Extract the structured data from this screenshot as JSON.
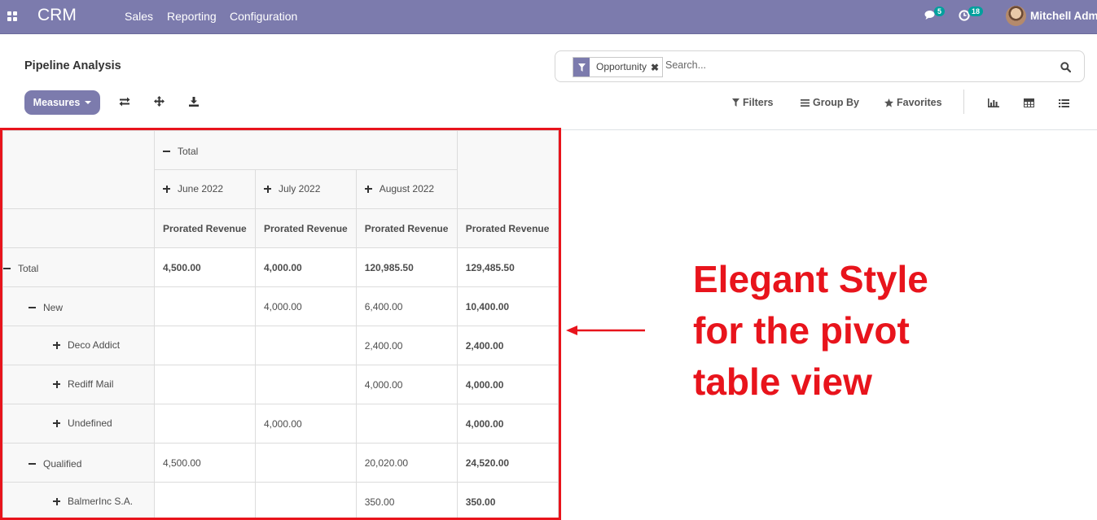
{
  "navbar": {
    "brand": "CRM",
    "menu": [
      "Sales",
      "Reporting",
      "Configuration"
    ],
    "messages_count": "5",
    "activities_count": "18",
    "user_name": "Mitchell Admin"
  },
  "control_panel": {
    "title": "Pipeline Analysis",
    "facet_value": "Opportunity",
    "search_placeholder": "Search...",
    "measures_label": "Measures",
    "filters_label": "Filters",
    "group_by_label": "Group By",
    "favorites_label": "Favorites"
  },
  "pivot": {
    "col_total_label": "Total",
    "col_groups": [
      "June 2022",
      "July 2022",
      "August 2022"
    ],
    "measure_label": "Prorated Revenue",
    "rows": [
      {
        "label": "Total",
        "values": [
          "4,500.00",
          "4,000.00",
          "120,985.50",
          "129,485.50"
        ]
      },
      {
        "label": "New",
        "values": [
          "",
          "4,000.00",
          "6,400.00",
          "10,400.00"
        ]
      },
      {
        "label": "Deco Addict",
        "values": [
          "",
          "",
          "2,400.00",
          "2,400.00"
        ]
      },
      {
        "label": "Rediff Mail",
        "values": [
          "",
          "",
          "4,000.00",
          "4,000.00"
        ]
      },
      {
        "label": "Undefined",
        "values": [
          "",
          "4,000.00",
          "",
          "4,000.00"
        ]
      },
      {
        "label": "Qualified",
        "values": [
          "4,500.00",
          "",
          "20,020.00",
          "24,520.00"
        ]
      },
      {
        "label": "BalmerInc S.A.",
        "values": [
          "",
          "",
          "350.00",
          "350.00"
        ]
      }
    ]
  },
  "annotation": {
    "lines": [
      "Elegant Style",
      "for the pivot",
      "table view"
    ],
    "color": "#e8141c"
  },
  "colors": {
    "navbar": "#7c7bad",
    "primary_button": "#7c7bad",
    "badge": "#00a09d"
  }
}
